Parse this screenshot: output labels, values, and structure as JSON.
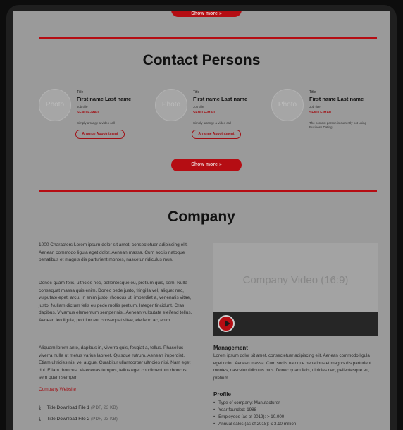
{
  "top_button": {
    "label": "Show more »"
  },
  "contacts": {
    "title": "Contact Persons",
    "photo_placeholder": "Photo",
    "items": [
      {
        "title": "Title",
        "name": "First name Last name",
        "job": "Job title",
        "email": "SEND E-MAIL",
        "note": "Simply arrange a video call",
        "button": "Arrange Appointment"
      },
      {
        "title": "Title",
        "name": "First name Last name",
        "job": "Job title",
        "email": "SEND E-MAIL",
        "note": "Simply arrange a video call",
        "button": "Arrange Appointment"
      },
      {
        "title": "Title",
        "name": "First name Last name",
        "job": "Job title",
        "email": "SEND E-MAIL",
        "note": "The contact person is currently not using Business Dating",
        "button": ""
      }
    ],
    "show_more": "Show more »"
  },
  "company": {
    "title": "Company",
    "paragraphs": [
      "1000 Characters Lorem ipsum dolor sit amet, consectetuer adipiscing elit. Aenean commodo ligula eget dolor. Aenean massa. Cum sociis natoque penatibus et magnis dis parturient montes, nascetur ridiculus mus.",
      "Donec quam felis, ultricies nec, pellentesque eu, pretium quis, sem. Nulla consequat massa quis enim. Donec pede justo, fringilla vel, aliquet nec, vulputate eget, arcu. In enim justo, rhoncus ut, imperdiet a, venenatis vitae, justo. Nullam dictum felis eu pede mollis pretium. Integer tincidunt. Cras dapibus. Vivamus elementum semper nisi. Aenean vulputate eleifend tellus. Aenean leo ligula, porttitor eu, consequat vitae, eleifend ac, enim.",
      "Aliquam lorem ante, dapibus in, viverra quis, feugiat a, tellus. Phasellus viverra nulla ut metus varius laoreet. Quisque rutrum. Aenean imperdiet. Etiam ultricies nisi vel augue. Curabitur ullamcorper ultricies nisi. Nam eget dui. Etiam rhoncus. Maecenas tempus, tellus eget condimentum rhoncus, sem quam semper."
    ],
    "website_link": "Company Website",
    "downloads": [
      {
        "label": "Title Download File 1",
        "meta": "(PDF, 23 KB)"
      },
      {
        "label": "Title Download File 2",
        "meta": "(PDF, 23 KB)"
      }
    ],
    "video_label": "Company Video (16:9)",
    "management": {
      "heading": "Management",
      "text": "Lorem ipsum dolor sit amet, consectetuer adipiscing elit. Aenean commodo ligula eget dolor. Aenean massa. Cum sociis natoque penatibus et magnis dis parturient montes, nascetur ridiculus mus. Donec quam felis, ultricies nec, pellentesque eu, pretium."
    },
    "profile": {
      "heading": "Profile",
      "items": [
        "Type of company: Manufacturer",
        "Year founded: 1988",
        "Employees (as of 2019): > 10.000",
        "Annual sales (as of 2018): € 3.10 million"
      ]
    }
  },
  "colors": {
    "accent": "#b50d13",
    "background": "#9a9a9a"
  },
  "icons": {
    "download": "download-icon",
    "play": "play-icon"
  }
}
